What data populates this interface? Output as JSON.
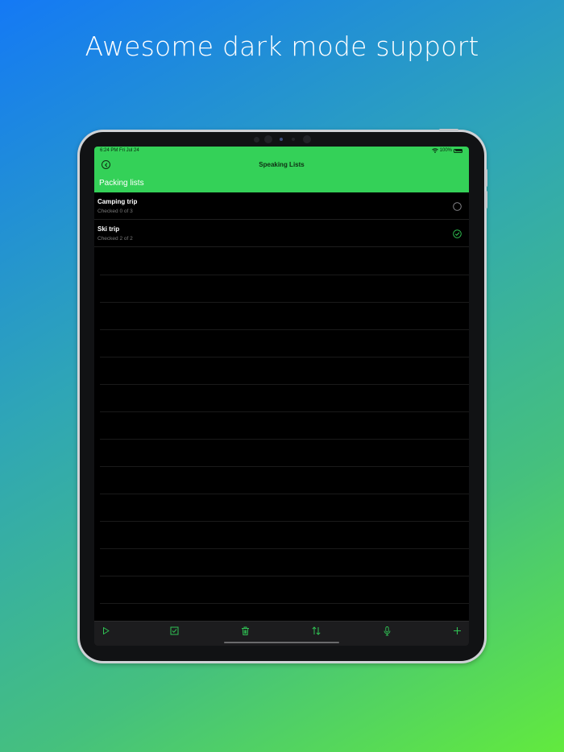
{
  "headline": "Awesome dark mode support",
  "status_bar": {
    "time": "6:24 PM   Fri Jul 24",
    "battery": "100%"
  },
  "nav": {
    "title": "Speaking Lists",
    "section_title": "Packing lists"
  },
  "lists": [
    {
      "title": "Camping trip",
      "subtitle": "Checked 0 of 3",
      "complete": false
    },
    {
      "title": "Ski trip",
      "subtitle": "Checked 2 of 2",
      "complete": true
    }
  ],
  "toolbar": {
    "icons": [
      "play-icon",
      "checkbox-icon",
      "trash-icon",
      "sort-icon",
      "microphone-icon",
      "plus-icon"
    ]
  },
  "colors": {
    "accent": "#34d158",
    "toolbar_icon": "#30c254",
    "background": "#000000"
  }
}
